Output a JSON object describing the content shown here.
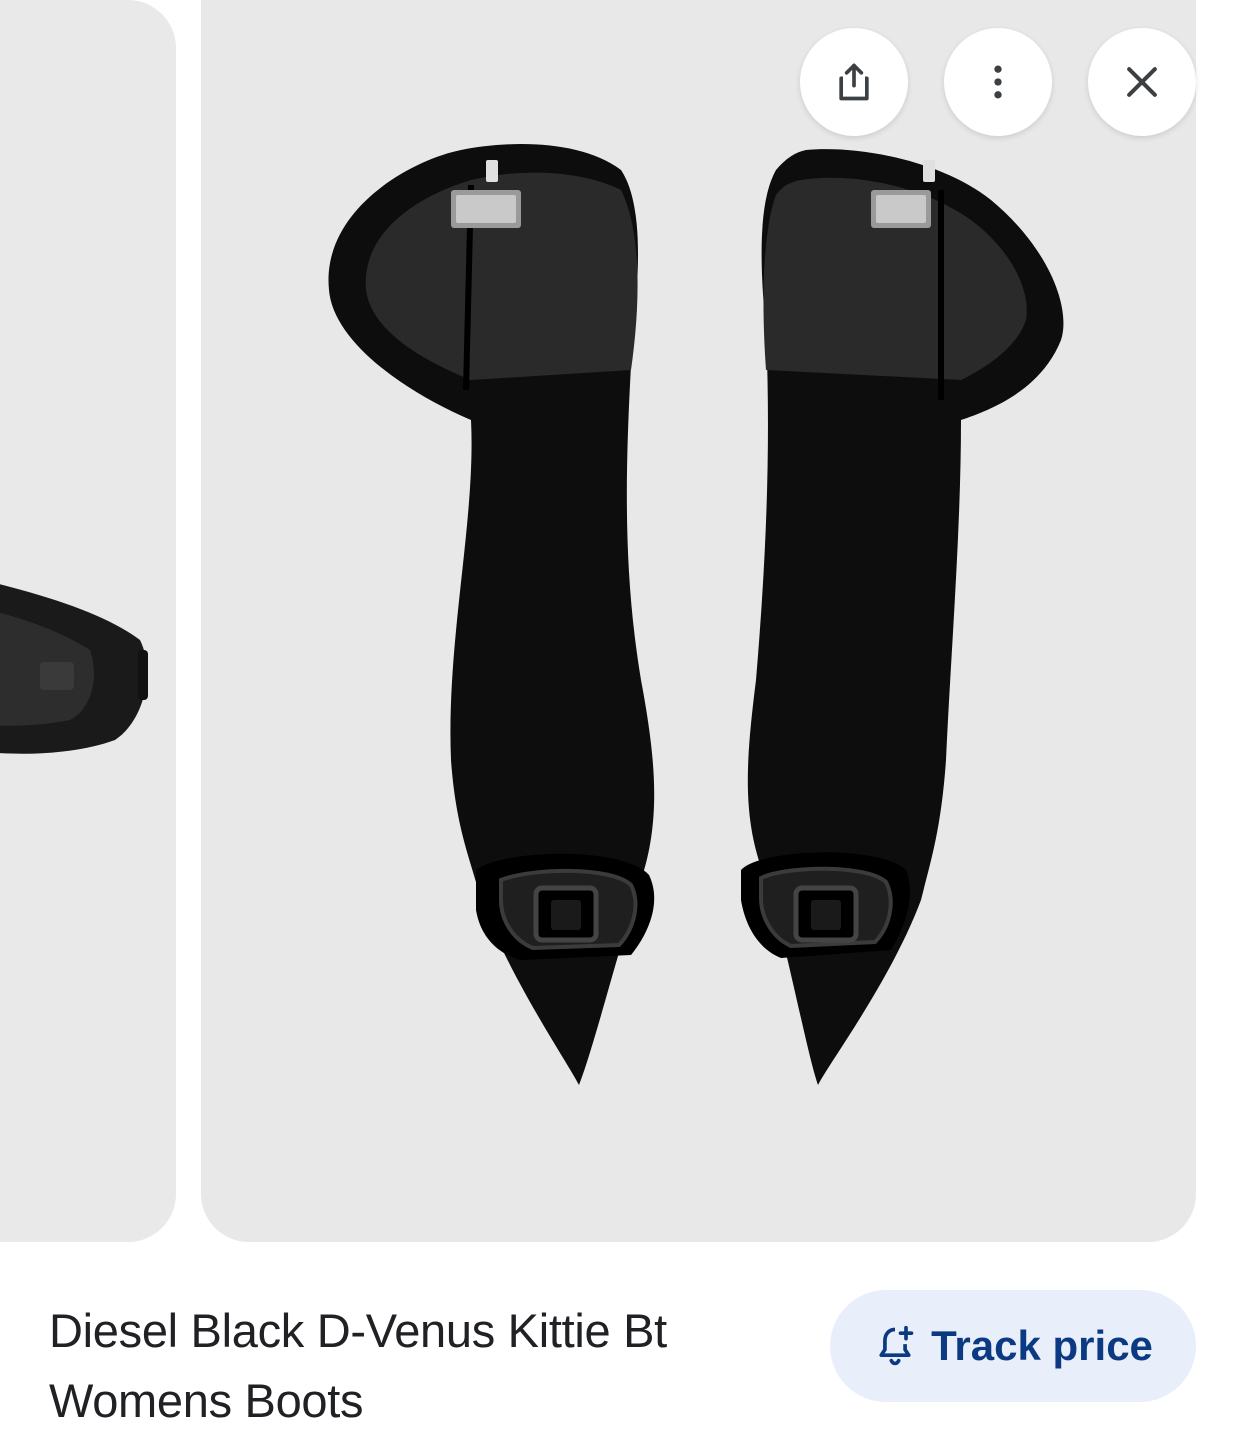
{
  "image_viewer": {
    "product_image_alt": "Diesel Black D-Venus Kittie Bt Womens Boots",
    "actions": {
      "share_icon": "share-icon",
      "more_icon": "more-vert-icon",
      "close_icon": "close-icon"
    }
  },
  "product": {
    "title": "Diesel Black D-Venus Kittie Bt Womens Boots",
    "track_price_label": "Track price",
    "track_price_icon": "bell-add-icon"
  },
  "colors": {
    "image_bg": "#e8e8e8",
    "track_btn_bg": "#e8eefa",
    "track_btn_text": "#0b3a82",
    "title_text": "#202124"
  }
}
